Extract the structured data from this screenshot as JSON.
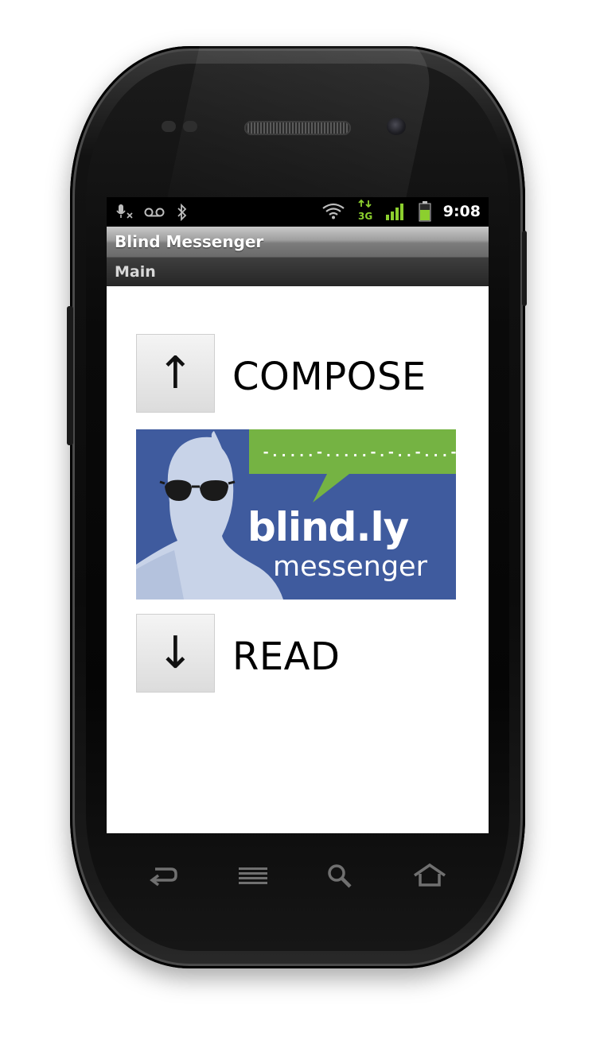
{
  "status_bar": {
    "time": "9:08",
    "network_type": "3G",
    "icons": [
      "mic-muted-icon",
      "voicemail-icon",
      "bluetooth-icon",
      "wifi-icon",
      "data-3g-icon",
      "signal-icon",
      "battery-icon"
    ]
  },
  "app": {
    "title": "Blind Messenger",
    "subtitle": "Main"
  },
  "actions": {
    "compose": {
      "arrow": "↑",
      "label": "COMPOSE"
    },
    "read": {
      "arrow": "↓",
      "label": "READ"
    }
  },
  "logo": {
    "wordmark": "blind.ly",
    "tagline": "messenger",
    "morse": "-.....-.....-.-..-...-.",
    "colors": {
      "background": "#3f5b9e",
      "bubble": "#75b343",
      "figure": "#c8d3e8"
    }
  },
  "nav_keys": [
    "back-icon",
    "menu-icon",
    "search-icon",
    "home-icon"
  ]
}
